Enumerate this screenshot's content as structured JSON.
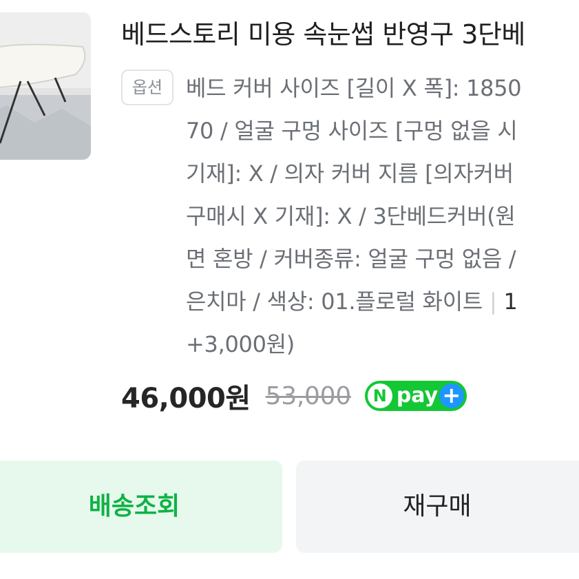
{
  "product": {
    "title": "베드스토리 미용 속눈썹 반영구 3단베",
    "option_badge": "옵션",
    "option_lines": [
      "베드 커버 사이즈 [길이 X 폭]: 1850",
      "70 / 얼굴 구멍 사이즈 [구멍 없을 시",
      "기재]: X / 의자 커버 지름 [의자커버",
      "구매시 X 기재]: X / 3단베드커버(원",
      "면 혼방 / 커버종류: 얼굴 구멍 없음 /"
    ],
    "option_last_line": "은치마 / 색상: 01.플로럴 화이트",
    "quantity": "1",
    "extra_price": "+3,000원)"
  },
  "price": {
    "sale": "46,000원",
    "original": "53,000"
  },
  "npay": {
    "n": "N",
    "label": "pay",
    "plus": "+",
    "color": "#14c735",
    "plus_color": "#1e96ff"
  },
  "buttons": {
    "delivery": "배송조회",
    "rebuy": "재구매"
  }
}
